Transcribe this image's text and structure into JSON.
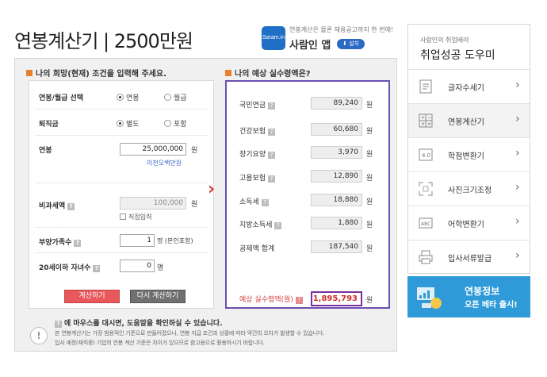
{
  "header": {
    "title": "연봉계산기 | 2500만원",
    "app_promo": {
      "tagline": "연봉계산은 물론 채용공고까지 한 번에!",
      "app_name": "사람인 앱",
      "install_label": "설치",
      "icon_text": "Saram.in"
    }
  },
  "input_section": {
    "title": "나의 희망(현재) 조건을 입력해 주세요.",
    "salary_type": {
      "label": "연봉/월급 선택",
      "options": [
        "연봉",
        "월급"
      ],
      "selected": "연봉"
    },
    "severance": {
      "label": "퇴직금",
      "options": [
        "별도",
        "포함"
      ],
      "selected": "별도"
    },
    "annual_salary": {
      "label": "연봉",
      "value": "25,000,000",
      "unit": "원",
      "link": "이천오백만원"
    },
    "nontaxable": {
      "label": "비과세액",
      "value": "100,000",
      "unit": "원",
      "checkbox_label": "직접입력"
    },
    "dependents": {
      "label": "부양가족수",
      "value": "1",
      "unit": "명 (본인포함)"
    },
    "children": {
      "label": "20세이하 자녀수",
      "value": "0",
      "unit": "명"
    },
    "calc_button": "계산하기",
    "reset_button": "다시 계산하기"
  },
  "result_section": {
    "title": "나의 예상 실수령액은?",
    "rows": [
      {
        "label": "국민연금",
        "value": "89,240",
        "unit": "원"
      },
      {
        "label": "건강보험",
        "value": "60,680",
        "unit": "원"
      },
      {
        "label": "장기요양",
        "value": "3,970",
        "unit": "원"
      },
      {
        "label": "고용보험",
        "value": "12,890",
        "unit": "원"
      },
      {
        "label": "소득세",
        "value": "18,880",
        "unit": "원"
      },
      {
        "label": "지방소득세",
        "value": "1,880",
        "unit": "원"
      }
    ],
    "deduction_total": {
      "label": "공제액 합계",
      "value": "187,540",
      "unit": "원"
    },
    "net_pay": {
      "label": "예상 실수령액(월)",
      "value": "1,895,793",
      "unit": "원"
    }
  },
  "notice": {
    "title": "에 마우스를 대시면, 도움말을 확인하실 수 있습니다.",
    "line1": "본 연봉계산기는 가장 범용적인 기준으로 만들어졌으나, 연봉 지급 조건과 상황에 따라 약간의 오차가 발생할 수 있습니다.",
    "line2": "입사 예정(재직중) 기업의 연봉 계산 기준은 차이가 있으므로 참고용으로 활용하시기 바랍니다."
  },
  "sidebar": {
    "subtitle": "사람인의 취업배려",
    "title": "취업성공 도우미",
    "items": [
      {
        "label": "글자수세기",
        "icon": "document-count-icon"
      },
      {
        "label": "연봉계산기",
        "icon": "calculator-icon"
      },
      {
        "label": "학점변환기",
        "icon": "grade-convert-icon"
      },
      {
        "label": "사진크기조정",
        "icon": "photo-resize-icon"
      },
      {
        "label": "어학변환기",
        "icon": "language-convert-icon"
      },
      {
        "label": "입사서류발급",
        "icon": "printer-icon"
      }
    ],
    "active_index": 1
  },
  "banner": {
    "line1": "연봉정보",
    "line2": "오픈 베타 출시!"
  },
  "colors": {
    "accent_red": "#e7575c",
    "result_border": "#6a4fb0",
    "section_marker": "#e77f2c",
    "banner_blue": "#2e9ad8"
  }
}
